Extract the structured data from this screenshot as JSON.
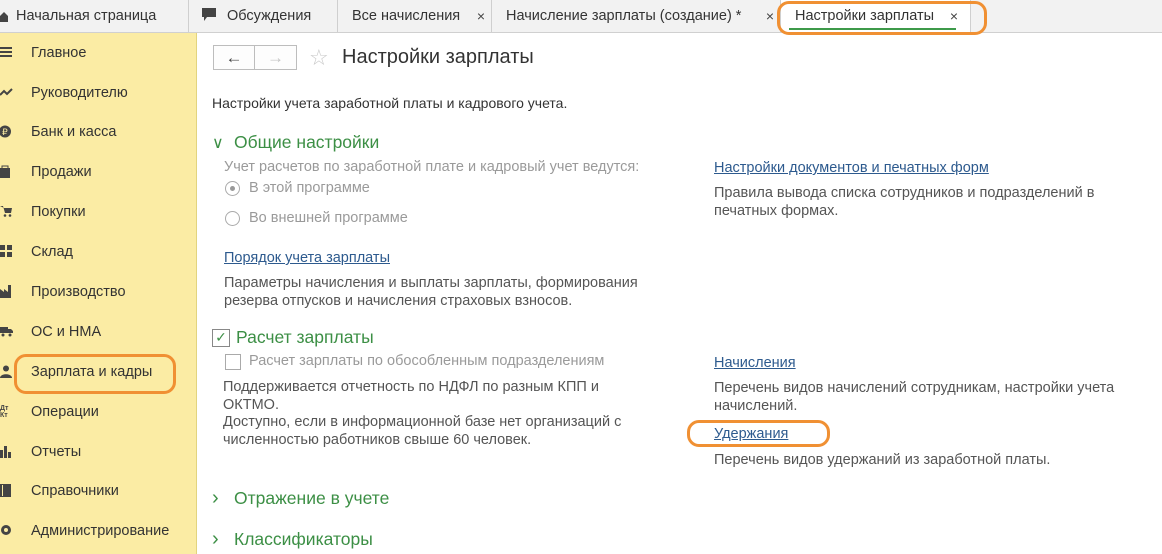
{
  "tabs": [
    {
      "label": "Начальная страница",
      "icon": "home-icon"
    },
    {
      "label": "Обсуждения",
      "icon": "chat-bubble-icon"
    },
    {
      "label": "Все начисления",
      "close": "×"
    },
    {
      "label": "Начисление зарплаты (создание) *",
      "close": "×"
    },
    {
      "label": "Настройки зарплаты",
      "close": "×",
      "active": true
    }
  ],
  "sidebar": {
    "items": [
      {
        "label": "Главное",
        "icon": "menu-lines-icon"
      },
      {
        "label": "Руководителю",
        "icon": "trend-chart-icon"
      },
      {
        "label": "Банк и касса",
        "icon": "ruble-coin-icon"
      },
      {
        "label": "Продажи",
        "icon": "shopping-bag-icon"
      },
      {
        "label": "Покупки",
        "icon": "shopping-cart-icon"
      },
      {
        "label": "Склад",
        "icon": "warehouse-grid-icon"
      },
      {
        "label": "Производство",
        "icon": "factory-icon"
      },
      {
        "label": "ОС и НМА",
        "icon": "truck-icon"
      },
      {
        "label": "Зарплата и кадры",
        "icon": "person-icon"
      },
      {
        "label": "Операции",
        "icon": "dt-kt-icon",
        "icon_text": "Дт\nКт"
      },
      {
        "label": "Отчеты",
        "icon": "bar-chart-icon"
      },
      {
        "label": "Справочники",
        "icon": "book-icon"
      },
      {
        "label": "Администрирование",
        "icon": "gear-icon"
      }
    ]
  },
  "header": {
    "back": "←",
    "forward": "→",
    "star": "☆",
    "title": "Настройки зарплаты",
    "subtitle": "Настройки учета заработной платы и кадрового учета."
  },
  "general": {
    "heading": "Общие настройки",
    "chevron": "∨",
    "question": "Учет расчетов по заработной плате и кадровый учет ведутся:",
    "option_this": "В этой программе",
    "option_external": "Во внешней программе",
    "order_link": "Порядок учета зарплаты",
    "order_desc": "Параметры начисления и выплаты зарплаты, формирования резерва отпусков и начисления страховых взносов.",
    "docs_link": "Настройки документов и печатных форм",
    "docs_desc": "Правила вывода списка сотрудников и подразделений в печатных формах."
  },
  "payroll": {
    "heading": "Расчет зарплаты",
    "check_mark": "✓",
    "separate_label": "Расчет зарплаты по обособленным подразделениям",
    "note1": "Поддерживается отчетность по НДФЛ по разным КПП и ОКТМО.",
    "note2": "Доступно, если в информационной базе нет организаций с численностью работников свыше 60 человек.",
    "accruals_link": "Начисления",
    "accruals_desc": "Перечень видов начислений сотрудникам, настройки учета начислений.",
    "deductions_link": "Удержания",
    "deductions_desc": "Перечень видов удержаний из заработной платы."
  },
  "collapsed": {
    "chevron": "›",
    "accounting": "Отражение в учете",
    "classifiers": "Классификаторы"
  },
  "colors": {
    "sidebar_bg": "#fbeca4",
    "section_green": "#3c8f45",
    "link_blue": "#2d5a8e",
    "highlight_orange": "#f09033"
  }
}
